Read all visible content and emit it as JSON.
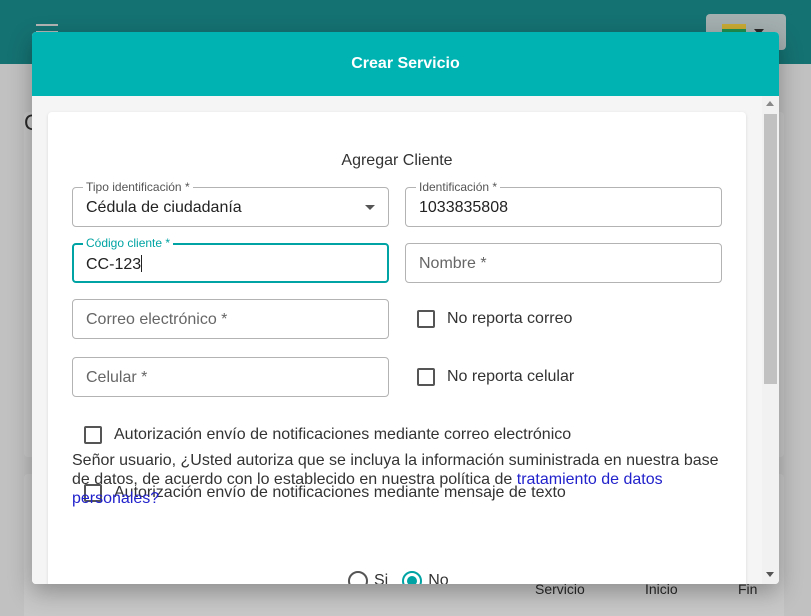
{
  "app": {
    "flag_colors": [
      "#f4d03f",
      "#27ae60",
      "#e74c3c"
    ],
    "bg_heading": "C",
    "table_headers": [
      "Servicio",
      "Inicio",
      "Fin"
    ]
  },
  "dialog": {
    "title": "Crear Servicio",
    "form_title": "Agregar Cliente",
    "fields": {
      "tipo_identificacion": {
        "label": "Tipo identificación *",
        "value": "Cédula de ciudadanía"
      },
      "identificacion": {
        "label": "Identificación *",
        "value": "1033835808"
      },
      "codigo_cliente": {
        "label": "Código cliente *",
        "value": "CC-123"
      },
      "nombre": {
        "placeholder": "Nombre *"
      },
      "correo": {
        "placeholder": "Correo electrónico *"
      },
      "celular": {
        "placeholder": "Celular *"
      }
    },
    "checkboxes": {
      "no_reporta_correo": "No reporta correo",
      "no_reporta_celular": "No reporta celular",
      "autorizacion_correo": "Autorización envío de notificaciones mediante correo electrónico",
      "autorizacion_texto": "Autorización envío de notificaciones mediante mensaje de texto"
    },
    "consent": {
      "text": "Señor usuario, ¿Usted autoriza que se incluya la información suministrada en nuestra base de datos, de acuerdo con lo establecido en nuestra política de ",
      "link": "tratamiento de datos personales?"
    },
    "radio": {
      "yes": "Si",
      "no": "No",
      "selected": "No"
    }
  },
  "colors": {
    "header": "#00b3b3",
    "accent": "#00a3a3",
    "link": "#2222cc"
  }
}
